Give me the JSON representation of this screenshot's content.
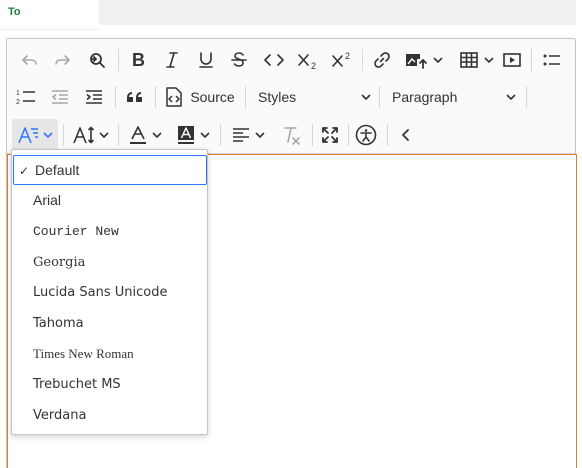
{
  "header": {
    "to_label": "To"
  },
  "toolbar": {
    "source_label": "Source",
    "styles_label": "Styles",
    "heading_label": "Paragraph"
  },
  "font_family_menu": {
    "selected": "Default",
    "items": [
      {
        "label": "Default",
        "font": "default"
      },
      {
        "label": "Arial",
        "font": "Arial"
      },
      {
        "label": "Courier New",
        "font": "Courier New"
      },
      {
        "label": "Georgia",
        "font": "Georgia"
      },
      {
        "label": "Lucida Sans Unicode",
        "font": "Lucida Sans Unicode"
      },
      {
        "label": "Tahoma",
        "font": "Tahoma"
      },
      {
        "label": "Times New Roman",
        "font": "Times New Roman"
      },
      {
        "label": "Trebuchet MS",
        "font": "Trebuchet MS"
      },
      {
        "label": "Verdana",
        "font": "Verdana"
      }
    ]
  },
  "colors": {
    "to_label": "#1a7f37",
    "focus_border": "#e27f2d",
    "selection_border": "#2977ff"
  }
}
